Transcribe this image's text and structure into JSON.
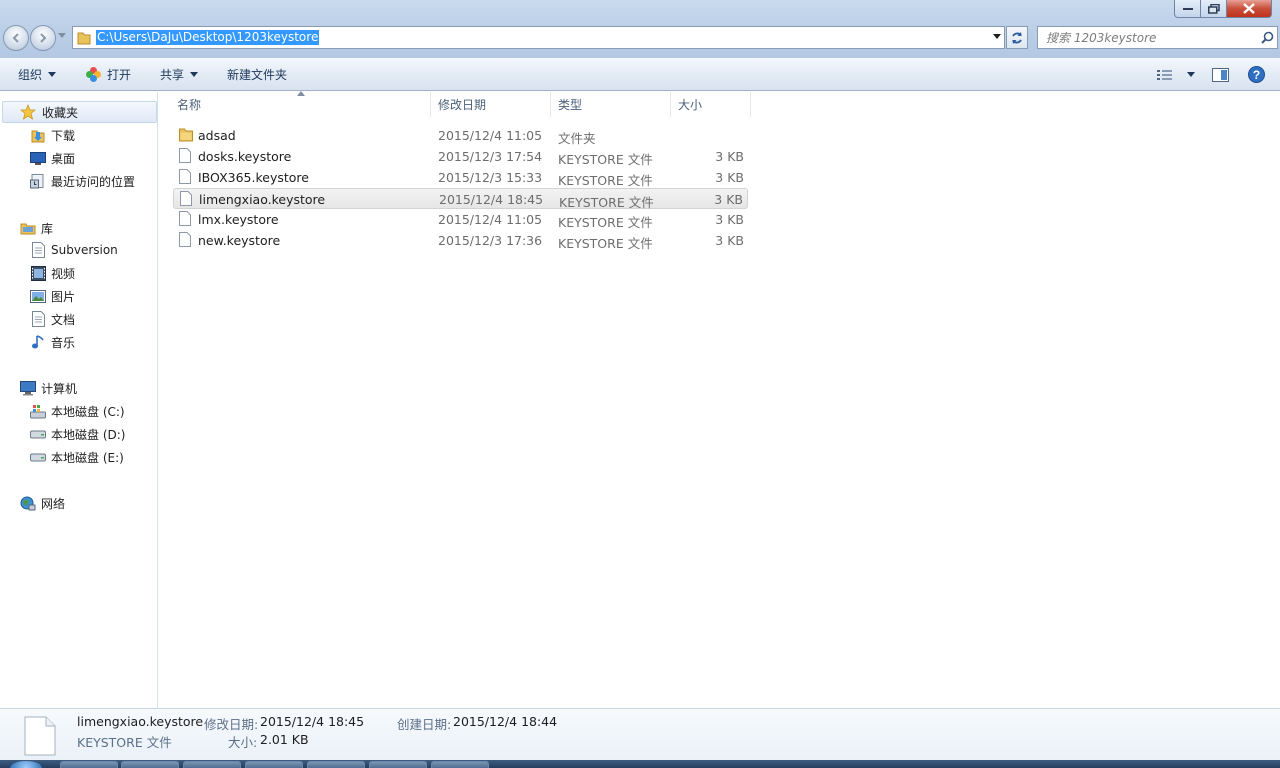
{
  "address": {
    "path": "C:\\Users\\DaJu\\Desktop\\1203keystore",
    "search_placeholder": "搜索 1203keystore"
  },
  "toolbar": {
    "organize": "组织",
    "open": "打开",
    "share": "共享",
    "new_folder": "新建文件夹"
  },
  "nav": {
    "favorites": {
      "label": "收藏夹",
      "items": [
        {
          "label": "下载",
          "icon": "download-folder-icon"
        },
        {
          "label": "桌面",
          "icon": "desktop-icon"
        },
        {
          "label": "最近访问的位置",
          "icon": "recent-places-icon"
        }
      ]
    },
    "libraries": {
      "label": "库",
      "items": [
        {
          "label": "Subversion",
          "icon": "document-icon"
        },
        {
          "label": "视频",
          "icon": "video-icon"
        },
        {
          "label": "图片",
          "icon": "picture-icon"
        },
        {
          "label": "文档",
          "icon": "document-icon"
        },
        {
          "label": "音乐",
          "icon": "music-icon"
        }
      ]
    },
    "computer": {
      "label": "计算机",
      "items": [
        {
          "label": "本地磁盘 (C:)",
          "icon": "system-drive-icon"
        },
        {
          "label": "本地磁盘 (D:)",
          "icon": "drive-icon"
        },
        {
          "label": "本地磁盘 (E:)",
          "icon": "drive-icon"
        }
      ]
    },
    "network": {
      "label": "网络",
      "icon": "network-icon"
    }
  },
  "columns": {
    "name": "名称",
    "date": "修改日期",
    "type": "类型",
    "size": "大小"
  },
  "files": [
    {
      "name": "adsad",
      "date": "2015/12/4 11:05",
      "type": "文件夹",
      "size": "",
      "icon": "folder-icon"
    },
    {
      "name": "dosks.keystore",
      "date": "2015/12/3 17:54",
      "type": "KEYSTORE 文件",
      "size": "3 KB",
      "icon": "file-icon"
    },
    {
      "name": "IBOX365.keystore",
      "date": "2015/12/3 15:33",
      "type": "KEYSTORE 文件",
      "size": "3 KB",
      "icon": "file-icon"
    },
    {
      "name": "limengxiao.keystore",
      "date": "2015/12/4 18:45",
      "type": "KEYSTORE 文件",
      "size": "3 KB",
      "icon": "file-icon",
      "selected": true
    },
    {
      "name": "lmx.keystore",
      "date": "2015/12/4 11:05",
      "type": "KEYSTORE 文件",
      "size": "3 KB",
      "icon": "file-icon"
    },
    {
      "name": "new.keystore",
      "date": "2015/12/3 17:36",
      "type": "KEYSTORE 文件",
      "size": "3 KB",
      "icon": "file-icon"
    }
  ],
  "details": {
    "filename": "limengxiao.keystore",
    "filetype": "KEYSTORE 文件",
    "modified_label": "修改日期:",
    "modified_value": "2015/12/4 18:45",
    "created_label": "创建日期:",
    "created_value": "2015/12/4 18:44",
    "size_label": "大小:",
    "size_value": "2.01 KB"
  },
  "colors": {
    "selection": "#3399ff",
    "link_text": "#1e395b"
  }
}
